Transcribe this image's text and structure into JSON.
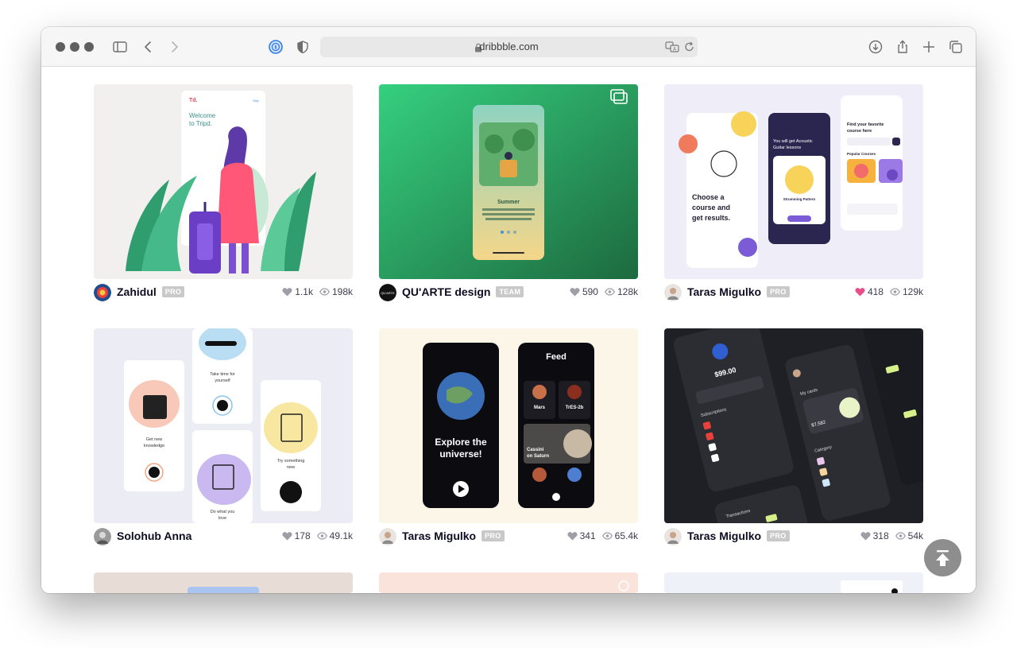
{
  "browser": {
    "url": "dribbble.com"
  },
  "shots": [
    {
      "author": "Zahidul",
      "badge": "PRO",
      "likes": "1.1k",
      "views": "198k",
      "liked": false
    },
    {
      "author": "QU'ARTE design",
      "badge": "TEAM",
      "likes": "590",
      "views": "128k",
      "liked": false
    },
    {
      "author": "Taras Migulko",
      "badge": "PRO",
      "likes": "418",
      "views": "129k",
      "liked": true
    },
    {
      "author": "Solohub Anna",
      "badge": "",
      "likes": "178",
      "views": "49.1k",
      "liked": false
    },
    {
      "author": "Taras Migulko",
      "badge": "PRO",
      "likes": "341",
      "views": "65.4k",
      "liked": false
    },
    {
      "author": "Taras Migulko",
      "badge": "PRO",
      "likes": "318",
      "views": "54k",
      "liked": false
    }
  ],
  "shot_text": {
    "tripd_brand": "Td.",
    "tripd_skip": "Skip",
    "tripd_welcome_1": "Welcome",
    "tripd_welcome_2": "to Tripd.",
    "summer_title": "Summer",
    "guitar_choose_1": "Choose a",
    "guitar_choose_2": "course and",
    "guitar_choose_3": "get results.",
    "guitar_get": "You will get Acoustic",
    "guitar_lessons": "Guitar lessons",
    "guitar_pattern": "Strumming Pattern",
    "guitar_find_1": "Find your favorite",
    "guitar_find_2": "course here",
    "guitar_popular": "Popular Courses",
    "anna_take_time": "Take time for",
    "anna_yourself": "yourself",
    "anna_get_new": "Get new",
    "anna_knowledge": "knowledge",
    "anna_try": "Try something",
    "anna_new": "new",
    "anna_do_what": "Do what you",
    "anna_love": "love",
    "space_explore": "Explore the",
    "space_universe": "universe!",
    "space_feed": "Feed",
    "space_mars": "Mars",
    "space_tres": "TrES-2b",
    "space_cassini": "Cassini",
    "space_saturn": "on Saturn",
    "bank_amount": "$99.00",
    "bank_subs": "Subscriptions",
    "bank_mycards": "My cards",
    "bank_category": "Category",
    "bank_transactions": "Transactions",
    "bank_balance": "$7,582"
  },
  "colors": {
    "liked_heart": "#ea4c89",
    "heart": "#9e9ea7",
    "badge": "#c9c9c9"
  }
}
